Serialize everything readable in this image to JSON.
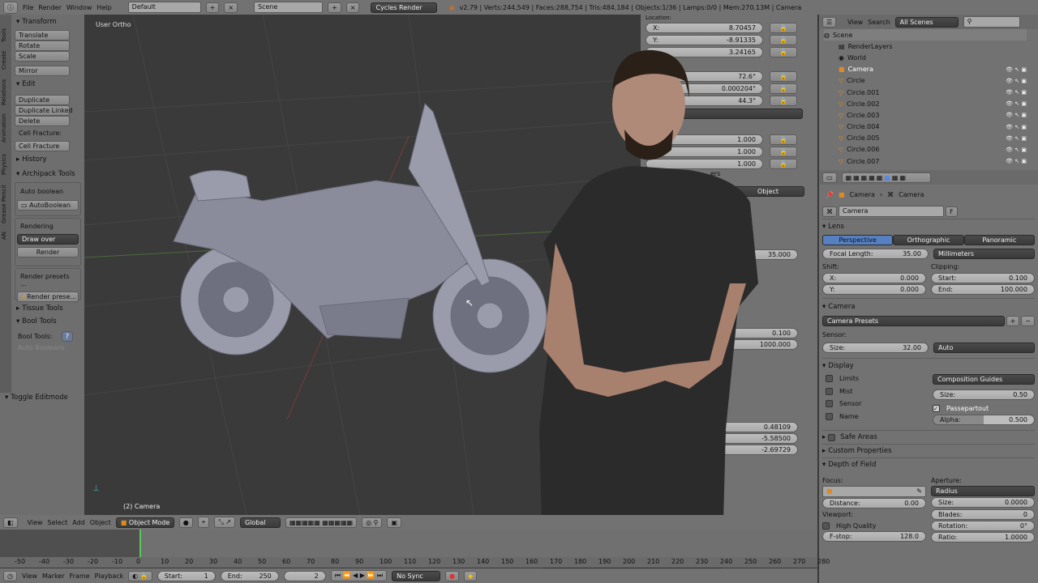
{
  "topbar": {
    "menus": [
      "File",
      "Render",
      "Window",
      "Help"
    ],
    "layout": "Default",
    "scene": "Scene",
    "engine": "Cycles Render",
    "stats": "v2.79 | Verts:244,549 | Faces:288,754 | Tris:484,184 | Objects:1/36 | Lamps:0/0 | Mem:270.13M | Camera"
  },
  "tool_tabs": [
    "Tools",
    "Create",
    "Relations",
    "Animation",
    "Physics",
    "Grease Pencil",
    "AN"
  ],
  "tools": {
    "transform": "Transform",
    "translate": "Translate",
    "rotate": "Rotate",
    "scale": "Scale",
    "mirror": "Mirror",
    "edit": "Edit",
    "duplicate": "Duplicate",
    "duplicate_linked": "Duplicate Linked",
    "delete": "Delete",
    "cell_fracture_label": "Cell Fracture:",
    "cell_fracture": "Cell Fracture",
    "history": "History",
    "archipack": "Archipack Tools",
    "auto_boolean_label": "Auto boolean",
    "auto_boolean": "AutoBoolean",
    "rendering": "Rendering",
    "draw_over": "Draw over",
    "render": "Render",
    "render_presets_label": "Render presets ...",
    "render_presets": "Render prese...",
    "tissue": "Tissue Tools",
    "bool_tools": "Bool Tools",
    "bool_tools_label": "Bool Tools:",
    "auto_booleans": "Auto Booleans",
    "toggle_editmode": "Toggle Editmode"
  },
  "viewport": {
    "label": "User Ortho",
    "object_label": "(2) Camera"
  },
  "npanel": {
    "location_label": "Location:",
    "loc": [
      {
        "k": "X:",
        "v": "8.70457"
      },
      {
        "k": "Y:",
        "v": "-8.91335"
      },
      {
        "k": "",
        "v": "3.24165"
      }
    ],
    "rot": [
      "72.6°",
      "0.000204°",
      "44.3°"
    ],
    "scale": [
      "1.000",
      "1.000",
      "1.000"
    ],
    "partial": "ers",
    "object_tab": "Object",
    "focal": "35.000",
    "clip": [
      "0.100",
      "1000.000"
    ],
    "cam_loc": [
      "0.48109",
      "-5.58500",
      "-2.69729"
    ]
  },
  "outliner": {
    "view": "View",
    "search": "Search",
    "scenes": "All Scenes",
    "items": [
      "Scene",
      "RenderLayers",
      "World",
      "Camera",
      "Circle",
      "Circle.001",
      "Circle.002",
      "Circle.003",
      "Circle.004",
      "Circle.005",
      "Circle.006",
      "Circle.007"
    ]
  },
  "props": {
    "crumb1": "Camera",
    "crumb2": "Camera",
    "data_name": "Camera",
    "fake": "F",
    "lens": "Lens",
    "lens_types": [
      "Perspective",
      "Orthographic",
      "Panoramic"
    ],
    "focal_label": "Focal Length:",
    "focal_value": "35.00",
    "units": "Millimeters",
    "shift": "Shift:",
    "clipping": "Clipping:",
    "shift_x": "X:",
    "shift_x_v": "0.000",
    "shift_y": "Y:",
    "shift_y_v": "0.000",
    "clip_start": "Start:",
    "clip_start_v": "0.100",
    "clip_end": "End:",
    "clip_end_v": "100.000",
    "camera": "Camera",
    "presets": "Camera Presets",
    "sensor": "Sensor:",
    "size": "Size:",
    "sensor_size": "32.00",
    "sensor_fit": "Auto",
    "display": "Display",
    "limits": "Limits",
    "mist": "Mist",
    "sensor_chk": "Sensor",
    "name": "Name",
    "comp_guides": "Composition Guides",
    "guide_size": "0.50",
    "passepartout": "Passepartout",
    "alpha": "Alpha:",
    "alpha_v": "0.500",
    "alpha_fraction": 0.5,
    "safe_areas": "Safe Areas",
    "custom_props": "Custom Properties",
    "dof": "Depth of Field",
    "focus": "Focus:",
    "aperture": "Aperture:",
    "radius": "Radius",
    "distance": "Distance:",
    "distance_v": "0.00",
    "ap_size_v": "0.0000",
    "viewport": "Viewport:",
    "high_quality": "High Quality",
    "blades": "Blades:",
    "blades_v": "0",
    "rotation": "Rotation:",
    "rotation_v": "0°",
    "fstop": "F-stop:",
    "fstop_v": "128.0",
    "ratio": "Ratio:",
    "ratio_v": "1.0000"
  },
  "view_header": {
    "menus": [
      "View",
      "Select",
      "Add",
      "Object"
    ],
    "mode": "Object Mode",
    "orientation": "Global"
  },
  "timeline": {
    "ticks": [
      "-50",
      "-40",
      "-30",
      "-20",
      "-10",
      "0",
      "10",
      "20",
      "30",
      "40",
      "50",
      "60",
      "70",
      "80",
      "90",
      "100",
      "110",
      "120",
      "130",
      "140",
      "150",
      "160",
      "170",
      "180",
      "190",
      "200",
      "210",
      "220",
      "230",
      "240",
      "250",
      "260",
      "270",
      "280"
    ],
    "menus": [
      "View",
      "Marker",
      "Frame",
      "Playback"
    ],
    "start_label": "Start:",
    "start": "1",
    "end_label": "End:",
    "end": "250",
    "current": "2",
    "sync": "No Sync"
  }
}
